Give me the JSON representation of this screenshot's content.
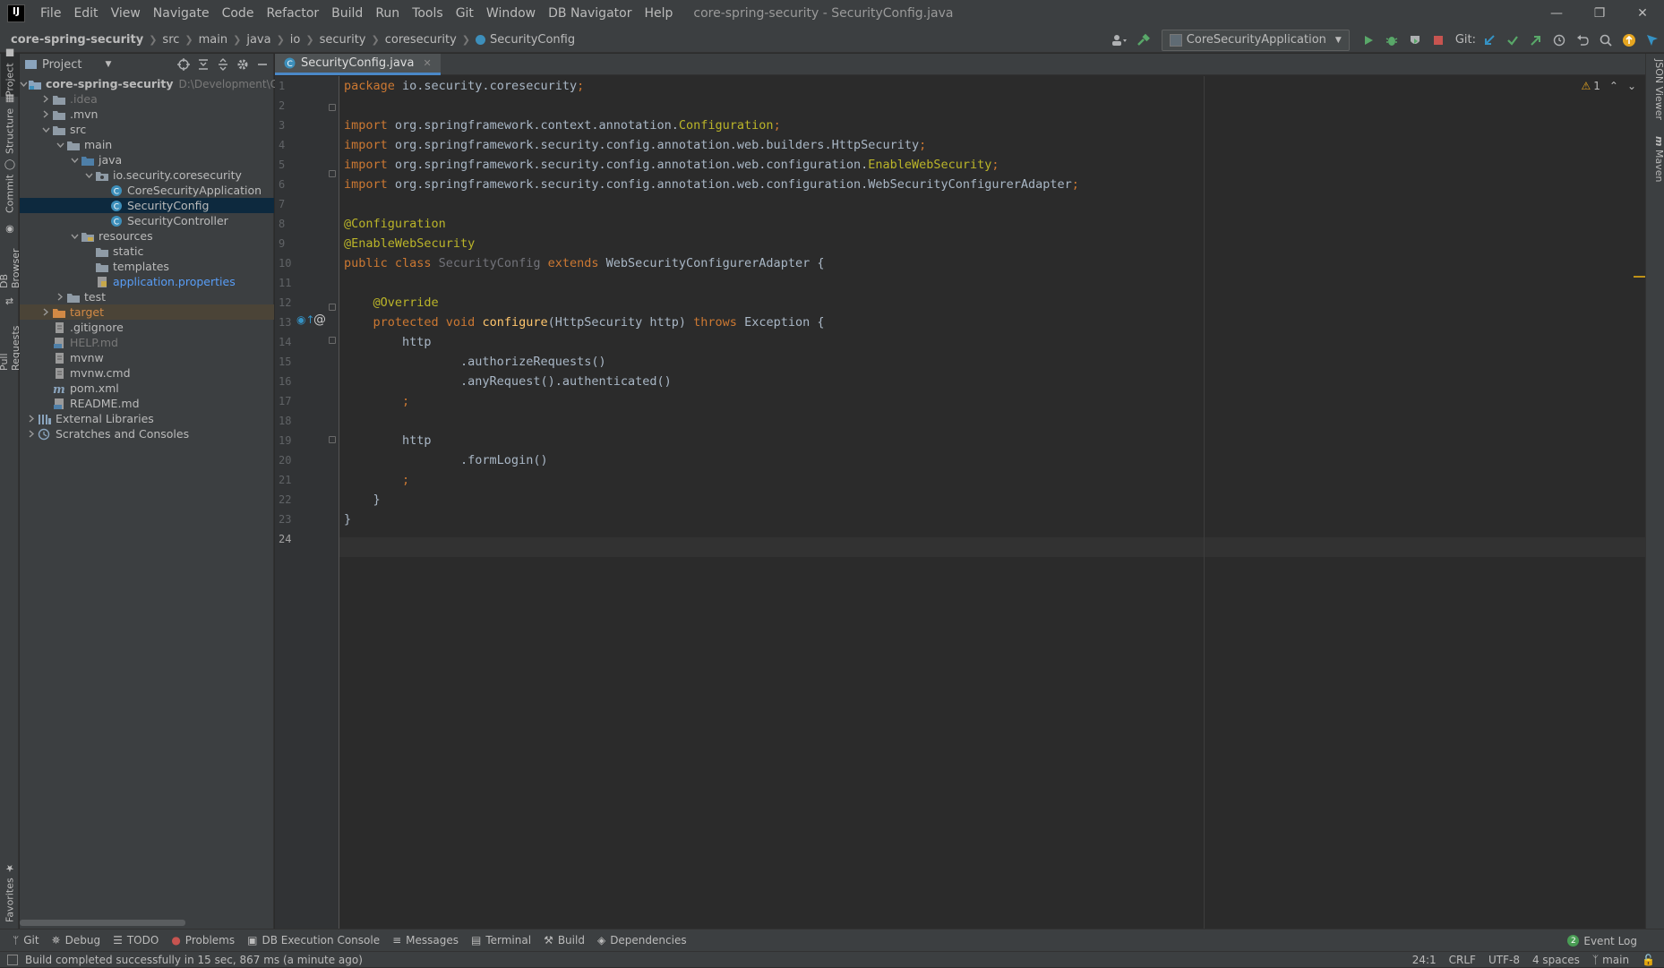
{
  "menu": {
    "items": [
      "File",
      "Edit",
      "View",
      "Navigate",
      "Code",
      "Refactor",
      "Build",
      "Run",
      "Tools",
      "Git",
      "Window",
      "DB Navigator",
      "Help"
    ],
    "window_title": "core-spring-security - SecurityConfig.java"
  },
  "breadcrumb": [
    "core-spring-security",
    "src",
    "main",
    "java",
    "io",
    "security",
    "coresecurity",
    "SecurityConfig"
  ],
  "toolbar": {
    "run_config": "CoreSecurityApplication",
    "git_label": "Git:"
  },
  "left_strip": {
    "tabs": [
      "Project",
      "Structure",
      "Commit",
      "DB Browser",
      "Pull Requests",
      "Favorites"
    ]
  },
  "right_strip": {
    "tabs": [
      "JSON Viewer",
      "Maven"
    ]
  },
  "project_panel": {
    "title": "Project",
    "tree": [
      {
        "label": "core-spring-security",
        "hint": "D:\\Development\\Git",
        "depth": 0,
        "arrow": "down",
        "icon": "module-folder",
        "style": "bold"
      },
      {
        "label": ".idea",
        "depth": 1,
        "arrow": "right",
        "icon": "folder",
        "style": "muted"
      },
      {
        "label": ".mvn",
        "depth": 1,
        "arrow": "right",
        "icon": "folder"
      },
      {
        "label": "src",
        "depth": 1,
        "arrow": "down",
        "icon": "folder"
      },
      {
        "label": "main",
        "depth": 2,
        "arrow": "down",
        "icon": "folder"
      },
      {
        "label": "java",
        "depth": 3,
        "arrow": "down",
        "icon": "source-folder"
      },
      {
        "label": "io.security.coresecurity",
        "depth": 4,
        "arrow": "down",
        "icon": "package"
      },
      {
        "label": "CoreSecurityApplication",
        "depth": 5,
        "arrow": "",
        "icon": "class"
      },
      {
        "label": "SecurityConfig",
        "depth": 5,
        "arrow": "",
        "icon": "class",
        "state": "selected"
      },
      {
        "label": "SecurityController",
        "depth": 5,
        "arrow": "",
        "icon": "class"
      },
      {
        "label": "resources",
        "depth": 3,
        "arrow": "down",
        "icon": "resource-folder"
      },
      {
        "label": "static",
        "depth": 4,
        "arrow": "",
        "icon": "folder"
      },
      {
        "label": "templates",
        "depth": 4,
        "arrow": "",
        "icon": "folder"
      },
      {
        "label": "application.properties",
        "depth": 4,
        "arrow": "",
        "icon": "properties-file",
        "style": "link"
      },
      {
        "label": "test",
        "depth": 2,
        "arrow": "right",
        "icon": "folder"
      },
      {
        "label": "target",
        "depth": 1,
        "arrow": "right",
        "icon": "excluded-folder",
        "state": "excluded",
        "style": "orange"
      },
      {
        "label": ".gitignore",
        "depth": 1,
        "arrow": "",
        "icon": "file"
      },
      {
        "label": "HELP.md",
        "depth": 1,
        "arrow": "",
        "icon": "md-file",
        "style": "muted"
      },
      {
        "label": "mvnw",
        "depth": 1,
        "arrow": "",
        "icon": "file"
      },
      {
        "label": "mvnw.cmd",
        "depth": 1,
        "arrow": "",
        "icon": "file"
      },
      {
        "label": "pom.xml",
        "depth": 1,
        "arrow": "",
        "icon": "maven-file"
      },
      {
        "label": "README.md",
        "depth": 1,
        "arrow": "",
        "icon": "md-file"
      },
      {
        "label": "External Libraries",
        "depth": 0,
        "arrow": "right",
        "icon": "library"
      },
      {
        "label": "Scratches and Consoles",
        "depth": 0,
        "arrow": "right",
        "icon": "scratches"
      }
    ]
  },
  "editor": {
    "tab_label": "SecurityConfig.java",
    "warning_count": "1",
    "current_line": 24,
    "lines": [
      [
        [
          "kw",
          "package "
        ],
        [
          "cls",
          "io.security.coresecurity"
        ],
        [
          "kw",
          ";"
        ]
      ],
      [],
      [
        [
          "kw",
          "import "
        ],
        [
          "cls",
          "org.springframework.context.annotation."
        ],
        [
          "yel",
          "Configuration"
        ],
        [
          "kw",
          ";"
        ]
      ],
      [
        [
          "kw",
          "import "
        ],
        [
          "cls",
          "org.springframework.security.config.annotation.web.builders.HttpSecurity"
        ],
        [
          "kw",
          ";"
        ]
      ],
      [
        [
          "kw",
          "import "
        ],
        [
          "cls",
          "org.springframework.security.config.annotation.web.configuration."
        ],
        [
          "yel",
          "EnableWebSecurity"
        ],
        [
          "kw",
          ";"
        ]
      ],
      [
        [
          "kw",
          "import "
        ],
        [
          "cls",
          "org.springframework.security.config.annotation.web.configuration.WebSecurityConfigurerAdapter"
        ],
        [
          "kw",
          ";"
        ]
      ],
      [],
      [
        [
          "ann",
          "@Configuration"
        ]
      ],
      [
        [
          "ann",
          "@EnableWebSecurity"
        ]
      ],
      [
        [
          "kw",
          "public class "
        ],
        [
          "unused",
          "SecurityConfig "
        ],
        [
          "kw",
          "extends "
        ],
        [
          "cls",
          "WebSecurityConfigurerAdapter {"
        ]
      ],
      [],
      [
        [
          "cls",
          "    "
        ],
        [
          "ann",
          "@Override"
        ]
      ],
      [
        [
          "cls",
          "    "
        ],
        [
          "kw",
          "protected void "
        ],
        [
          "fn",
          "configure"
        ],
        [
          "cls",
          "(HttpSecurity http) "
        ],
        [
          "kw",
          "throws "
        ],
        [
          "cls",
          "Exception {"
        ]
      ],
      [
        [
          "cls",
          "        http"
        ]
      ],
      [
        [
          "cls",
          "                .authorizeRequests()"
        ]
      ],
      [
        [
          "cls",
          "                .anyRequest().authenticated()"
        ]
      ],
      [
        [
          "cls",
          "        "
        ],
        [
          "kw",
          ";"
        ]
      ],
      [],
      [
        [
          "cls",
          "        http"
        ]
      ],
      [
        [
          "cls",
          "                .formLogin()"
        ]
      ],
      [
        [
          "cls",
          "        "
        ],
        [
          "kw",
          ";"
        ]
      ],
      [
        [
          "cls",
          "    }"
        ]
      ],
      [
        [
          "cls",
          "}"
        ]
      ],
      []
    ]
  },
  "bottom_tabs": [
    "Git",
    "Debug",
    "TODO",
    "Problems",
    "DB Execution Console",
    "Messages",
    "Terminal",
    "Build",
    "Dependencies"
  ],
  "event_log": {
    "label": "Event Log",
    "count": "2"
  },
  "status": {
    "message": "Build completed successfully in 15 sec, 867 ms (a minute ago)",
    "position": "24:1",
    "line_sep": "CRLF",
    "encoding": "UTF-8",
    "indent": "4 spaces",
    "branch": "main"
  },
  "colors": {
    "accent": "#4a88c7",
    "keyword": "#cc7832",
    "annotation": "#bbb529",
    "method": "#ffc66d",
    "run_green": "#59a869",
    "stop_red": "#c75450"
  }
}
